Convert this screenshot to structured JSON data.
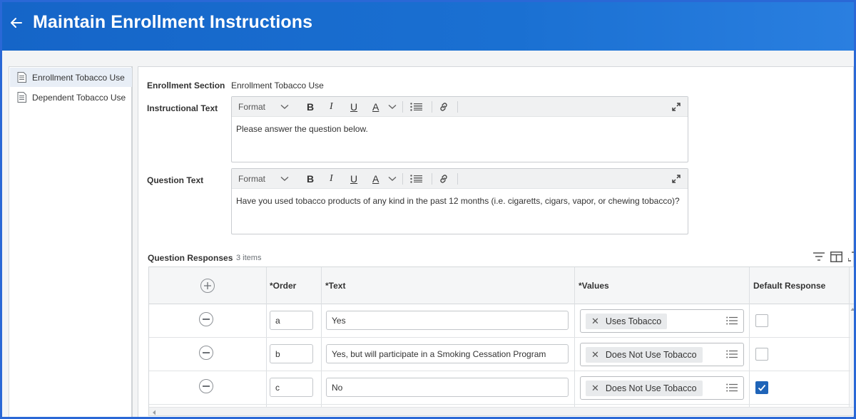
{
  "header": {
    "title": "Maintain Enrollment Instructions",
    "back_icon": "arrow-left-icon"
  },
  "sidebar": {
    "items": [
      {
        "label": "Enrollment Tobacco Use",
        "icon": "document-icon",
        "active": true
      },
      {
        "label": "Dependent Tobacco Use",
        "icon": "document-icon",
        "active": false
      }
    ]
  },
  "form": {
    "section_label": "Enrollment Section",
    "section_value": "Enrollment Tobacco Use",
    "instructional_label": "Instructional Text",
    "instructional_text": "Please answer the question below.",
    "question_label": "Question Text",
    "question_text": "Have you used tobacco products of any kind in the past 12 months (i.e. cigaretts, cigars, vapor, or chewing tobacco)?"
  },
  "toolbar": {
    "format_label": "Format",
    "bold": "B",
    "italic": "I",
    "underline": "U",
    "font_color": "A"
  },
  "responses": {
    "title": "Question Responses",
    "count": "3 items",
    "columns": {
      "order": "*Order",
      "text": "*Text",
      "values": "*Values",
      "default": "Default Response"
    },
    "rows": [
      {
        "order": "a",
        "text": "Yes",
        "value": "Uses Tobacco",
        "default": false
      },
      {
        "order": "b",
        "text": "Yes, but will participate in a Smoking Cessation Program",
        "value": "Does Not Use Tobacco",
        "default": false
      },
      {
        "order": "c",
        "text": "No",
        "value": "Does Not Use Tobacco",
        "default": true
      }
    ]
  },
  "colors": {
    "header_blue": "#1565c8",
    "checkbox_blue": "#1f64b8"
  }
}
